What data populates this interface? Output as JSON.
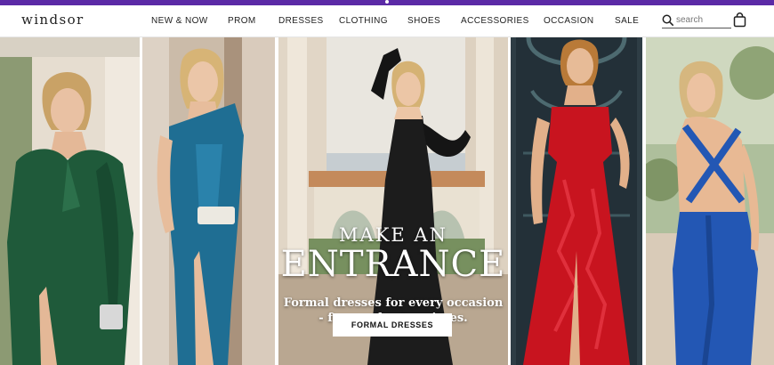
{
  "brand": {
    "logo_text": "windsor"
  },
  "colors": {
    "promo_bar": "#5b2aa6",
    "text": "#222222"
  },
  "nav": {
    "items": [
      {
        "label": "NEW & NOW"
      },
      {
        "label": "PROM"
      },
      {
        "label": "DRESSES"
      },
      {
        "label": "CLOTHING"
      },
      {
        "label": "SHOES"
      },
      {
        "label": "ACCESSORIES"
      },
      {
        "label": "OCCASION"
      },
      {
        "label": "SALE"
      }
    ]
  },
  "search": {
    "placeholder": "search",
    "icon": "search-icon"
  },
  "cart": {
    "icon": "shopping-bag-icon"
  },
  "hero": {
    "headline_line1": "MAKE AN",
    "headline_line2": "ENTRANCE",
    "subheadline": "Formal dresses for every occasion - from galas to soirees.",
    "cta_label": "FORMAL DRESSES",
    "panels": [
      {
        "dress": "green velvet one-shoulder gown",
        "color": "#1f5a3a"
      },
      {
        "dress": "teal satin one-shoulder gown",
        "color": "#1f6e93"
      },
      {
        "dress": "black column gown with opera gloves",
        "color": "#1c1c1c"
      },
      {
        "dress": "red lace corset gown",
        "color": "#c8141f"
      },
      {
        "dress": "royal blue satin open-back gown",
        "color": "#2357b4"
      }
    ]
  }
}
